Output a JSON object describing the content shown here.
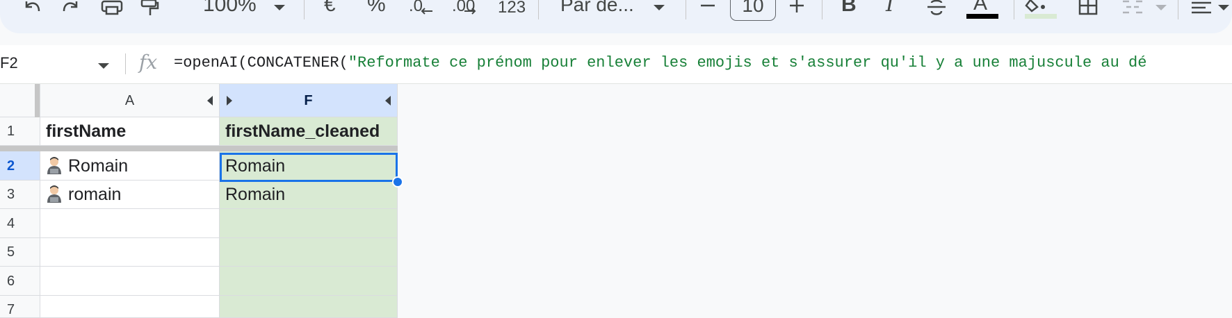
{
  "toolbar": {
    "zoom": "100%",
    "currency": "€",
    "percent": "%",
    "decrease_decimals": ".0",
    "increase_decimals": ".00",
    "number_format": "123",
    "font_name": "Par dé...",
    "font_size": "10",
    "bold": "B",
    "italic": "I",
    "text_color_letter": "A"
  },
  "formula_bar": {
    "name_box": "F2",
    "fx_label": "fx",
    "formula_prefix": "=openAI(CONCATENER(",
    "formula_string": "\"Reformate ce prénom pour enlever les emojis et s'assurer qu'il y a une majuscule au dé"
  },
  "columns": [
    {
      "letter": "A",
      "selected": false
    },
    {
      "letter": "F",
      "selected": true
    }
  ],
  "rows": [
    {
      "num": "1",
      "a": "firstName",
      "f": "firstName_cleaned",
      "bold": true,
      "emoji": false
    },
    {
      "num": "2",
      "a": "Romain",
      "f": "Romain",
      "bold": false,
      "emoji": true
    },
    {
      "num": "3",
      "a": "romain",
      "f": "Romain",
      "bold": false,
      "emoji": true
    },
    {
      "num": "4",
      "a": "",
      "f": ""
    },
    {
      "num": "5",
      "a": "",
      "f": ""
    },
    {
      "num": "6",
      "a": "",
      "f": ""
    },
    {
      "num": "7",
      "a": "",
      "f": ""
    }
  ],
  "colors": {
    "toolbar_bg": "#edf2fa",
    "selection": "#1a73e8",
    "f_column_fill": "#d9ead3",
    "formula_string": "#188038"
  }
}
